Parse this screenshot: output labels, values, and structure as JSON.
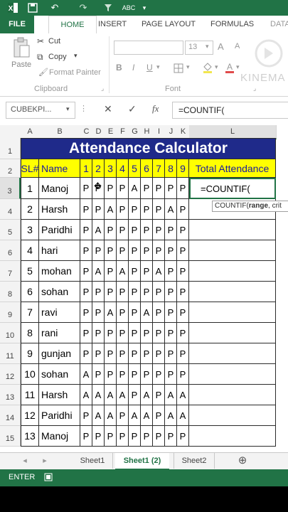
{
  "titlebar": {
    "app_icon": "excel-logo-icon",
    "save_icon": "save-icon",
    "undo_icon": "undo-icon",
    "redo_icon": "redo-icon",
    "filter_icon": "filter-icon",
    "spell_icon": "spellcheck-icon",
    "more_icon": "customize-qat-icon"
  },
  "tabs": {
    "file": "FILE",
    "home": "HOME",
    "insert": "INSERT",
    "page_layout": "PAGE LAYOUT",
    "formulas": "FORMULAS",
    "data": "DATA"
  },
  "ribbon": {
    "cut": "Cut",
    "copy": "Copy",
    "format_painter": "Format Painter",
    "paste": "Paste",
    "clipboard_group": "Clipboard",
    "font_group": "Font",
    "font_size": "13",
    "bold": "B",
    "italic": "I",
    "underline": "U",
    "grow": "A",
    "shrink": "A",
    "watermark": "KINEMA"
  },
  "formula_bar": {
    "name_box": "CUBEKPI...",
    "cancel": "✕",
    "enter": "✓",
    "fx": "fx",
    "content": "=COUNTIF("
  },
  "columns": [
    "A",
    "B",
    "C",
    "D",
    "E",
    "F",
    "G",
    "H",
    "I",
    "J",
    "K",
    "L"
  ],
  "rows": [
    "1",
    "2",
    "3",
    "4",
    "5",
    "6",
    "7",
    "8",
    "9",
    "10",
    "11",
    "12",
    "13",
    "14",
    "15"
  ],
  "title": "Attendance Calculator",
  "header": {
    "sl": "SL#",
    "name": "Name",
    "days": [
      "1",
      "2",
      "3",
      "4",
      "5",
      "6",
      "7",
      "8",
      "9"
    ],
    "total": "Total Attendance"
  },
  "records": [
    {
      "sl": "1",
      "name": "Manoj",
      "att": [
        "P",
        "P",
        "P",
        "P",
        "A",
        "P",
        "P",
        "P",
        "P"
      ],
      "total": "=COUNTIF("
    },
    {
      "sl": "2",
      "name": "Harsh",
      "att": [
        "P",
        "P",
        "A",
        "P",
        "P",
        "P",
        "P",
        "A",
        "P"
      ],
      "total": ""
    },
    {
      "sl": "3",
      "name": "Paridhi",
      "att": [
        "P",
        "A",
        "P",
        "P",
        "P",
        "P",
        "P",
        "P",
        "P"
      ],
      "total": ""
    },
    {
      "sl": "4",
      "name": "hari",
      "att": [
        "P",
        "P",
        "P",
        "P",
        "P",
        "P",
        "P",
        "P",
        "P"
      ],
      "total": ""
    },
    {
      "sl": "5",
      "name": "mohan",
      "att": [
        "P",
        "A",
        "P",
        "A",
        "P",
        "P",
        "A",
        "P",
        "P"
      ],
      "total": ""
    },
    {
      "sl": "6",
      "name": "sohan",
      "att": [
        "P",
        "P",
        "P",
        "P",
        "P",
        "P",
        "P",
        "P",
        "P"
      ],
      "total": ""
    },
    {
      "sl": "7",
      "name": "ravi",
      "att": [
        "P",
        "P",
        "A",
        "P",
        "P",
        "A",
        "P",
        "P",
        "P"
      ],
      "total": ""
    },
    {
      "sl": "8",
      "name": "rani",
      "att": [
        "P",
        "P",
        "P",
        "P",
        "P",
        "P",
        "P",
        "P",
        "P"
      ],
      "total": ""
    },
    {
      "sl": "9",
      "name": "gunjan",
      "att": [
        "P",
        "P",
        "P",
        "P",
        "P",
        "P",
        "P",
        "P",
        "P"
      ],
      "total": ""
    },
    {
      "sl": "10",
      "name": "sohan",
      "att": [
        "A",
        "P",
        "P",
        "P",
        "P",
        "P",
        "P",
        "P",
        "P"
      ],
      "total": ""
    },
    {
      "sl": "11",
      "name": "Harsh",
      "att": [
        "A",
        "A",
        "A",
        "A",
        "P",
        "A",
        "P",
        "A",
        "A"
      ],
      "total": ""
    },
    {
      "sl": "12",
      "name": "Paridhi",
      "att": [
        "P",
        "A",
        "A",
        "P",
        "A",
        "A",
        "P",
        "A",
        "A"
      ],
      "total": ""
    },
    {
      "sl": "13",
      "name": "Manoj",
      "att": [
        "P",
        "P",
        "P",
        "P",
        "P",
        "P",
        "P",
        "P",
        "P"
      ],
      "total": ""
    }
  ],
  "tooltip": {
    "fn": "COUNTIF(",
    "arg": "range",
    "rest": ", crit"
  },
  "sheet_tabs": {
    "s1": "Sheet1",
    "s2": "Sheet1 (2)",
    "s3": "Sheet2",
    "add": "⊕"
  },
  "status": {
    "mode": "ENTER"
  },
  "colors": {
    "excel_green": "#217346",
    "title_bg": "#1f2a8a",
    "header_bg": "#ffff00"
  }
}
